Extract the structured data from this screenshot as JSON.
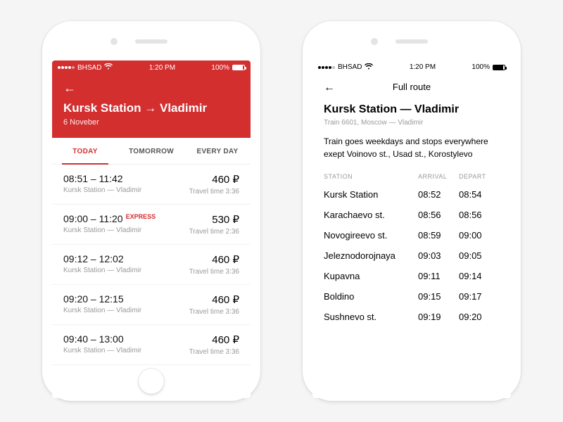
{
  "statusbar": {
    "carrier": "BHSAD",
    "time": "1:20 PM",
    "battery": "100%"
  },
  "screen1": {
    "route_from": "Kursk Station",
    "route_to": "Vladimir",
    "date": "6 Noveber",
    "tabs": [
      "TODAY",
      "TOMORROW",
      "EVERY DAY"
    ],
    "active_tab": 0,
    "trips": [
      {
        "depart": "08:51",
        "arrive": "11:42",
        "express": false,
        "from": "Kursk Station",
        "to": "Vladimir",
        "price": "460 ₽",
        "travel": "Travel time 3:36"
      },
      {
        "depart": "09:00",
        "arrive": "11:20",
        "express": true,
        "express_label": "EXPRESS",
        "from": "Kursk Station",
        "to": "Vladimir",
        "price": "530 ₽",
        "travel": "Travel time 2:36"
      },
      {
        "depart": "09:12",
        "arrive": "12:02",
        "express": false,
        "from": "Kursk Station",
        "to": "Vladimir",
        "price": "460 ₽",
        "travel": "Travel time 3:36"
      },
      {
        "depart": "09:20",
        "arrive": "12:15",
        "express": false,
        "from": "Kursk Station",
        "to": "Vladimir",
        "price": "460 ₽",
        "travel": "Travel time 3:36"
      },
      {
        "depart": "09:40",
        "arrive": "13:00",
        "express": false,
        "from": "Kursk Station",
        "to": "Vladimir",
        "price": "460 ₽",
        "travel": "Travel time 3:36"
      }
    ]
  },
  "screen2": {
    "title": "Full route",
    "heading_from": "Kursk Station",
    "heading_to": "Vladimir",
    "train_meta": "Train 6601, Moscow — Vladimir",
    "note": "Train goes weekdays and stops everywhere exept Voinovo st., Usad st., Korostylevo",
    "col_station": "STATION",
    "col_arrival": "ARRIVAL",
    "col_depart": "DEPART",
    "rows": [
      {
        "station": "Kursk Station",
        "arrive": "08:52",
        "depart": "08:54"
      },
      {
        "station": "Karachaevo st.",
        "arrive": "08:56",
        "depart": "08:56"
      },
      {
        "station": "Novogireevo st.",
        "arrive": "08:59",
        "depart": "09:00"
      },
      {
        "station": "Jeleznodorojnaya",
        "arrive": "09:03",
        "depart": "09:05"
      },
      {
        "station": "Kupavna",
        "arrive": "09:11",
        "depart": "09:14"
      },
      {
        "station": "Boldino",
        "arrive": "09:15",
        "depart": "09:17"
      },
      {
        "station": "Sushnevo st.",
        "arrive": "09:19",
        "depart": "09:20"
      }
    ]
  }
}
